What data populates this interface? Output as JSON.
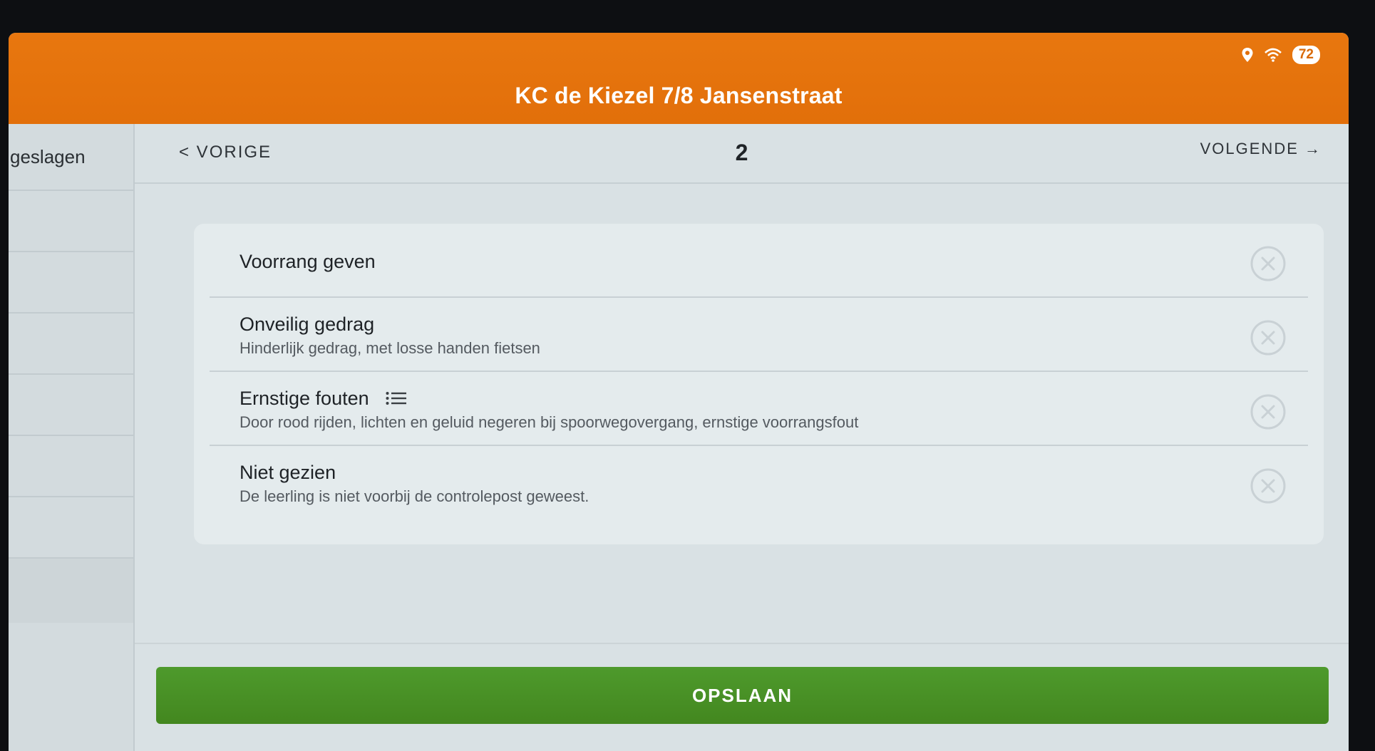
{
  "app": {
    "title": "KC de Kiezel 7/8 Jansenstraat"
  },
  "status_bar": {
    "battery": "72",
    "icons": [
      "location-icon",
      "wifi-icon"
    ]
  },
  "sidebar": {
    "header_label": "geslagen"
  },
  "pager": {
    "prev_label": "< VORIGE",
    "page": "2",
    "next_label": "VOLGENDE →"
  },
  "options": [
    {
      "title": "Voorrang geven",
      "subtitle": ""
    },
    {
      "title": "Onveilig gedrag",
      "subtitle": "Hinderlijk gedrag, met losse handen fietsen"
    },
    {
      "title": "Ernstige fouten",
      "subtitle": "Door rood rijden, lichten en geluid negeren bij spoorwegovergang, ernstige voorrangsfout"
    },
    {
      "title": "Niet gezien",
      "subtitle": "De leerling is niet voorbij de controlepost geweest."
    }
  ],
  "actions": {
    "save_label": "OPSLAAN"
  },
  "colors": {
    "appbar": "#e8770f",
    "save": "#4e9a2c",
    "background": "#d9e1e4"
  }
}
